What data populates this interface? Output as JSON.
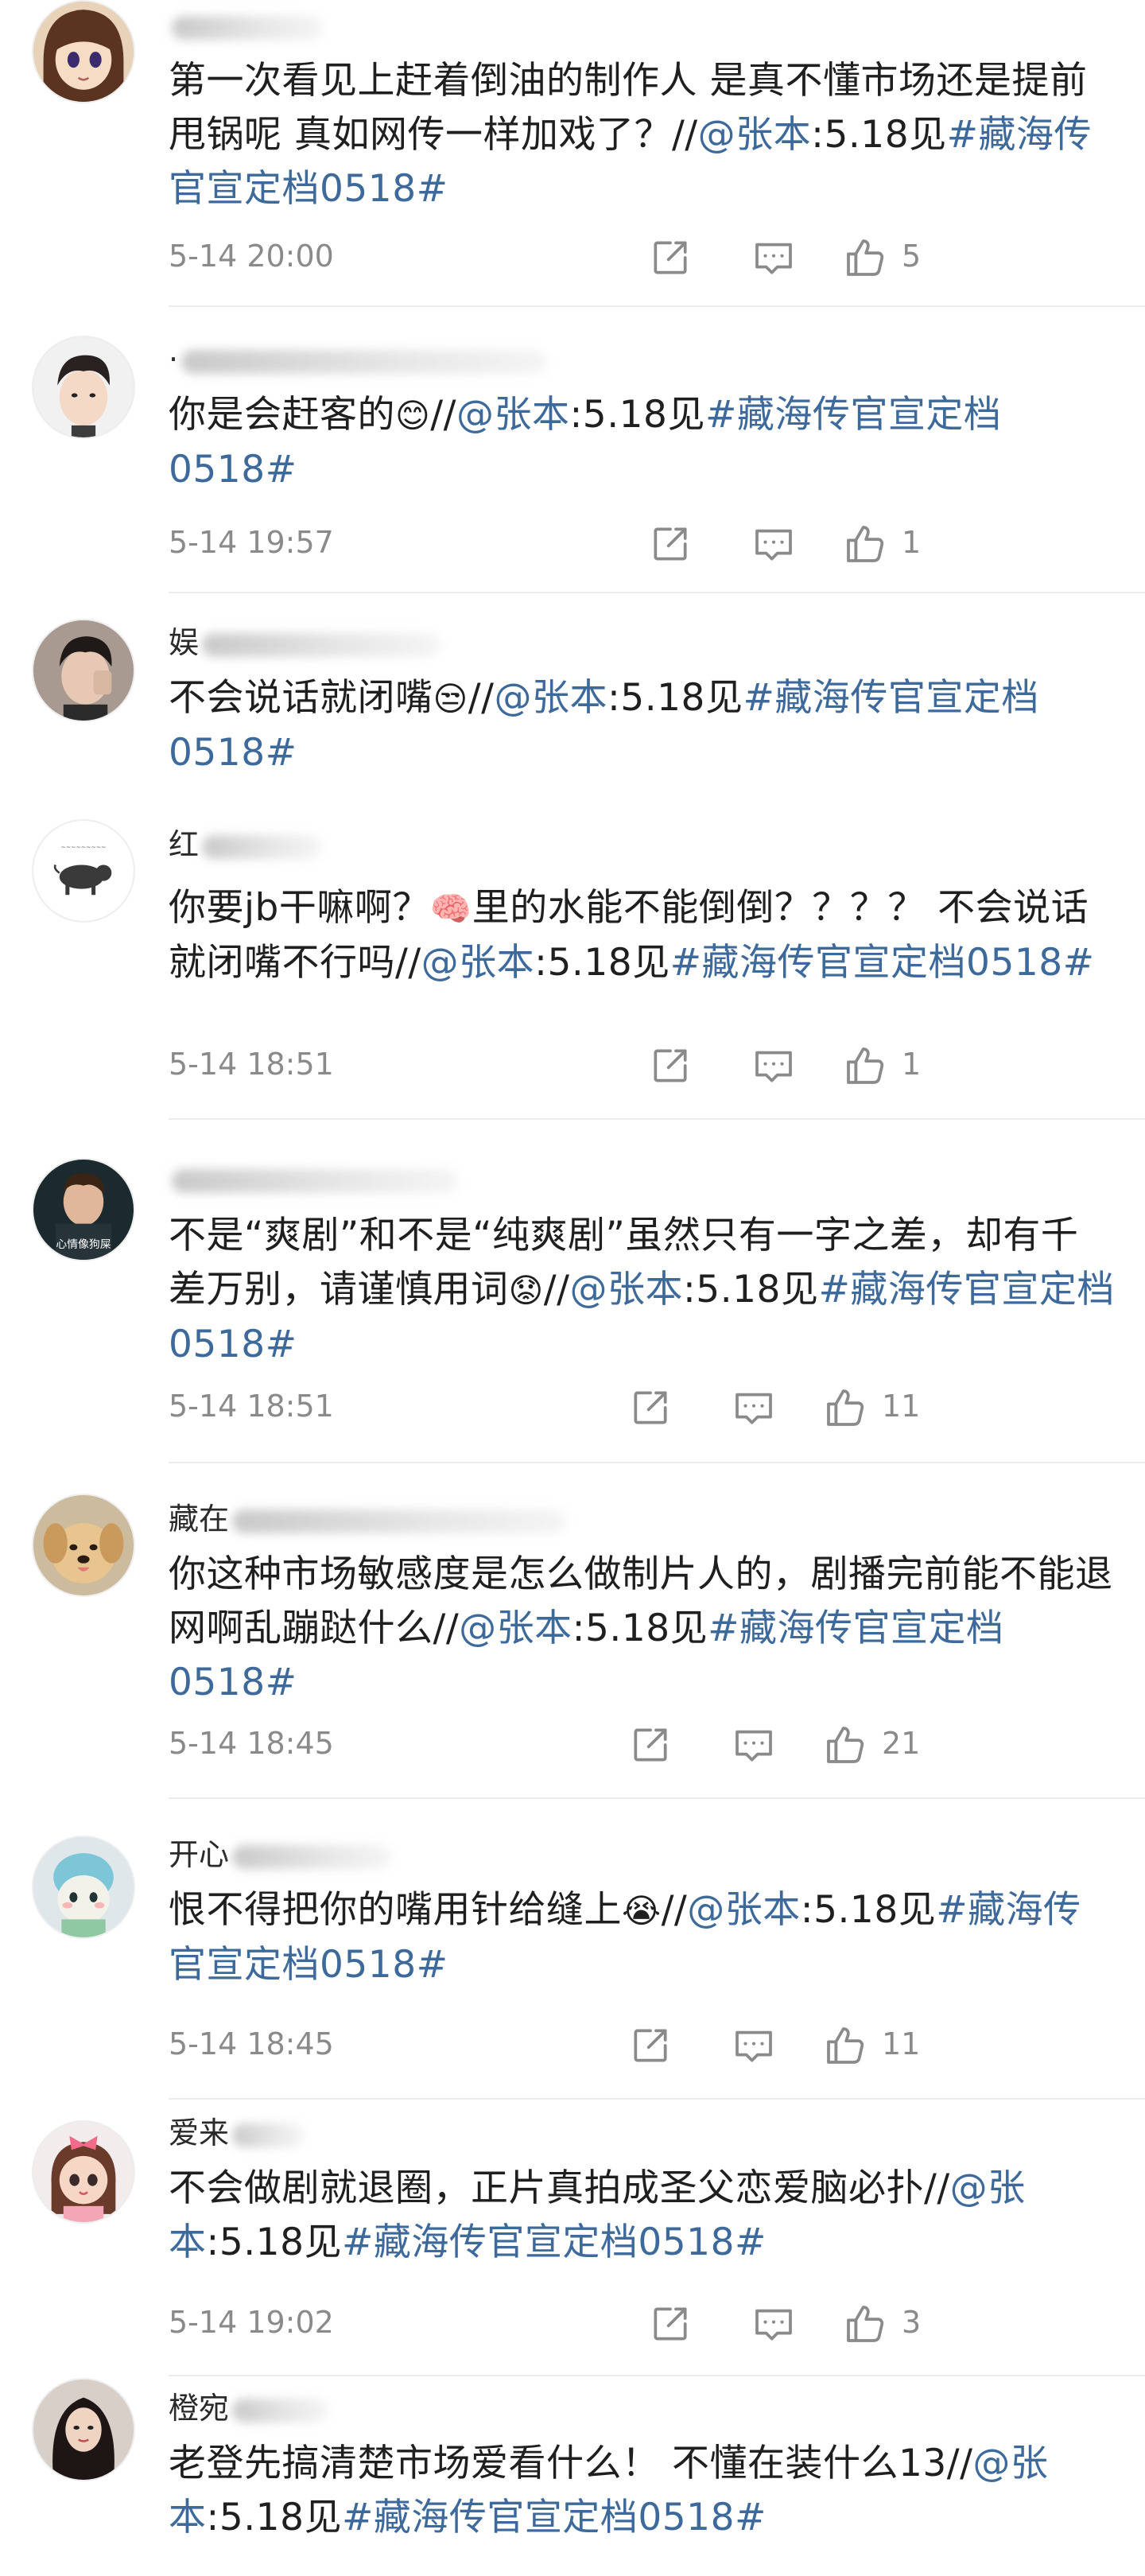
{
  "comments": [
    {
      "username_prefix": "",
      "segments": [
        {
          "t": "第一次看见上赶着倒油的制作人 是真不懂市场还是提前甩锅呢 真如网传一样加戏了？//",
          "k": "text"
        },
        {
          "t": "@张本",
          "k": "mention"
        },
        {
          "t": ":5.18见",
          "k": "text"
        },
        {
          "t": "#藏海传官宣定档0518#",
          "k": "tag"
        }
      ],
      "time": "5-14 20:00",
      "likes": "5"
    },
    {
      "username_prefix": "·",
      "segments": [
        {
          "t": "你是会赶客的",
          "k": "text"
        },
        {
          "t": "😊",
          "k": "emoji"
        },
        {
          "t": "//",
          "k": "text"
        },
        {
          "t": "@张本",
          "k": "mention"
        },
        {
          "t": ":5.18见",
          "k": "text"
        },
        {
          "t": "#藏海传官宣定档0518#",
          "k": "tag"
        }
      ],
      "time": "5-14 19:57",
      "likes": "1"
    },
    {
      "username_prefix": "娱",
      "segments": [
        {
          "t": "不会说话就闭嘴",
          "k": "text"
        },
        {
          "t": "😒",
          "k": "emoji"
        },
        {
          "t": "//",
          "k": "text"
        },
        {
          "t": "@张本",
          "k": "mention"
        },
        {
          "t": ":5.18见",
          "k": "text"
        },
        {
          "t": "#藏海传官宣定档0518#",
          "k": "tag"
        }
      ],
      "time": "",
      "likes": ""
    },
    {
      "username_prefix": "红",
      "segments": [
        {
          "t": "你要jb干嘛啊？",
          "k": "text"
        },
        {
          "t": "🧠",
          "k": "emoji"
        },
        {
          "t": "里的水能不能倒倒？？？？ 不会说话就闭嘴不行吗//",
          "k": "text"
        },
        {
          "t": "@张本",
          "k": "mention"
        },
        {
          "t": ":5.18见",
          "k": "text"
        },
        {
          "t": "#藏海传官宣定档0518#",
          "k": "tag"
        }
      ],
      "time": "5-14 18:51",
      "likes": "1"
    },
    {
      "username_prefix": "",
      "segments": [
        {
          "t": "不是“爽剧”和不是“纯爽剧”虽然只有一字之差，却有千差万别，请谨慎用词",
          "k": "text"
        },
        {
          "t": "😟",
          "k": "emoji"
        },
        {
          "t": "//",
          "k": "text"
        },
        {
          "t": "@张本",
          "k": "mention"
        },
        {
          "t": ":5.18见",
          "k": "text"
        },
        {
          "t": "#藏海传官宣定档0518#",
          "k": "tag"
        }
      ],
      "time": "5-14 18:51",
      "likes": "11"
    },
    {
      "username_prefix": "藏在",
      "segments": [
        {
          "t": "你这种市场敏感度是怎么做制片人的，剧播完前能不能退网啊乱蹦跶什么//",
          "k": "text"
        },
        {
          "t": "@张本",
          "k": "mention"
        },
        {
          "t": ":5.18见",
          "k": "text"
        },
        {
          "t": "#藏海传官宣定档0518#",
          "k": "tag"
        }
      ],
      "time": "5-14 18:45",
      "likes": "21"
    },
    {
      "username_prefix": "开心",
      "segments": [
        {
          "t": "恨不得把你的嘴用针给缝上",
          "k": "text"
        },
        {
          "t": "😭",
          "k": "emoji"
        },
        {
          "t": "//",
          "k": "text"
        },
        {
          "t": "@张本",
          "k": "mention"
        },
        {
          "t": ":5.18见",
          "k": "text"
        },
        {
          "t": "#藏海传官宣定档0518#",
          "k": "tag"
        }
      ],
      "time": "5-14 18:45",
      "likes": "11"
    },
    {
      "username_prefix": "爱来",
      "segments": [
        {
          "t": "不会做剧就退圈，正片真拍成圣父恋爱脑必扑//",
          "k": "text"
        },
        {
          "t": "@张本",
          "k": "mention"
        },
        {
          "t": ":5.18见",
          "k": "text"
        },
        {
          "t": "#藏海传官宣定档0518#",
          "k": "tag"
        }
      ],
      "time": "5-14 19:02",
      "likes": "3"
    },
    {
      "username_prefix": "橙宛",
      "segments": [
        {
          "t": "老登先搞清楚市场爱看什么！ 不懂在装什么13//",
          "k": "text"
        },
        {
          "t": "@张本",
          "k": "mention"
        },
        {
          "t": ":5.18见",
          "k": "text"
        },
        {
          "t": "#藏海传官宣定档0518#",
          "k": "tag"
        }
      ],
      "time": "",
      "likes": ""
    }
  ],
  "colors": {
    "link": "#3d6a9a",
    "meta": "#8a8a8a",
    "divider": "#ececec"
  },
  "icons": {
    "repost": "repost-icon",
    "comment": "comment-icon",
    "like": "thumbs-up-icon"
  }
}
